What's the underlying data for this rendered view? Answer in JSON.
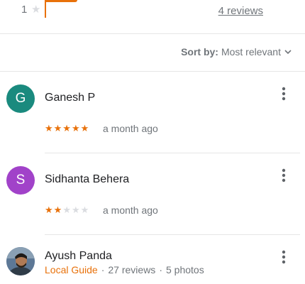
{
  "summary": {
    "rating_row_number": "1",
    "rating_row_star": "★",
    "reviews_link": "4 reviews"
  },
  "sort": {
    "label": "Sort by:",
    "value": "Most relevant"
  },
  "reviews": [
    {
      "initial": "G",
      "avatar_color": "#1a8a7e",
      "name": "Ganesh P",
      "rating": 5,
      "stars_on": "★★★★★",
      "stars_off": "",
      "time": "a month ago"
    },
    {
      "initial": "S",
      "avatar_color": "#a142c9",
      "name": "Sidhanta Behera",
      "rating": 2,
      "stars_on": "★★",
      "stars_off": "★★★",
      "time": "a month ago"
    },
    {
      "name": "Ayush Panda",
      "badge": "Local Guide",
      "review_count": "27 reviews",
      "photo_count": "5 photos",
      "separator": "·"
    }
  ],
  "colors": {
    "accent": "#e8710a",
    "star_empty": "#dadce0",
    "muted_text": "#70757a"
  }
}
